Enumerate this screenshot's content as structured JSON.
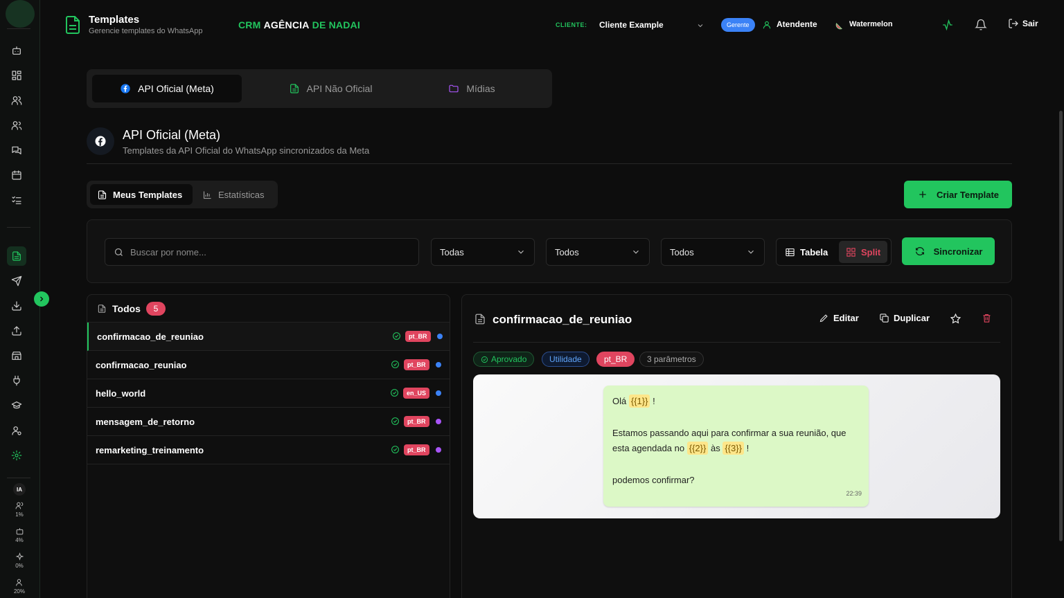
{
  "header": {
    "title": "Templates",
    "subtitle": "Gerencie templates do WhatsApp",
    "brand_prefix": "CRM",
    "brand_main": "AGÊNCIA",
    "brand_suffix": "DE NADAI",
    "client_label": "CLIENTE:",
    "client_value": "Cliente Example",
    "role_badge": "Gerente",
    "user_name": "Atendente",
    "workspace": "Watermelon",
    "logout_label": "Sair"
  },
  "sidebar": {
    "items": [
      "bot-icon",
      "dashboard-icon",
      "users-icon",
      "contacts-icon",
      "chat-icon",
      "calendar-icon",
      "tasks-icon",
      "templates-icon",
      "send-icon",
      "download-icon",
      "upload-icon",
      "store-icon",
      "plug-icon",
      "graduation-icon",
      "user-settings-icon",
      "settings-icon"
    ],
    "ia_label": "IA",
    "stats": [
      {
        "icon": "users-icon",
        "value": "1%"
      },
      {
        "icon": "bot-icon",
        "value": "4%"
      },
      {
        "icon": "sparkle-icon",
        "value": "0%"
      },
      {
        "icon": "user-icon",
        "value": "20%"
      }
    ]
  },
  "top_tabs": [
    {
      "label": "API Oficial (Meta)",
      "active": true
    },
    {
      "label": "API Não Oficial",
      "active": false
    },
    {
      "label": "Mídias",
      "active": false
    }
  ],
  "section": {
    "title": "API Oficial (Meta)",
    "subtitle": "Templates da API Oficial do WhatsApp sincronizados da Meta"
  },
  "sub_tabs": [
    {
      "label": "Meus Templates",
      "active": true
    },
    {
      "label": "Estatísticas",
      "active": false
    }
  ],
  "create_button": "Criar Template",
  "filters": {
    "search_placeholder": "Buscar por nome...",
    "select_1": "Todas",
    "select_2": "Todos",
    "select_3": "Todos",
    "view_table": "Tabela",
    "view_split": "Split",
    "sync_button": "Sincronizar"
  },
  "list": {
    "title": "Todos",
    "count": "5",
    "items": [
      {
        "name": "confirmacao_de_reuniao",
        "lang": "pt_BR",
        "dot": "#3b82f6",
        "selected": true
      },
      {
        "name": "confirmacao_reuniao",
        "lang": "pt_BR",
        "dot": "#3b82f6",
        "selected": false
      },
      {
        "name": "hello_world",
        "lang": "en_US",
        "dot": "#3b82f6",
        "selected": false
      },
      {
        "name": "mensagem_de_retorno",
        "lang": "pt_BR",
        "dot": "#a855f7",
        "selected": false
      },
      {
        "name": "remarketing_treinamento",
        "lang": "pt_BR",
        "dot": "#a855f7",
        "selected": false
      }
    ]
  },
  "detail": {
    "title": "confirmacao_de_reuniao",
    "edit": "Editar",
    "duplicate": "Duplicar",
    "tags": {
      "status": "Aprovado",
      "category": "Utilidade",
      "lang": "pt_BR",
      "params": "3 parâmetros"
    },
    "message": {
      "greeting": "Olá",
      "var1": "{{1}}",
      "bang1": "!",
      "line2a": "Estamos passando aqui para confirmar a sua reunião, que",
      "line2b": "esta agendada no",
      "var2": "{{2}}",
      "as": "às",
      "var3": "{{3}}",
      "bang2": "!",
      "line3": "podemos confirmar?",
      "time": "22:39"
    }
  },
  "colors": {
    "accent": "#22c55e",
    "danger": "#e0455f",
    "info": "#3b82f6",
    "purple": "#a855f7"
  }
}
